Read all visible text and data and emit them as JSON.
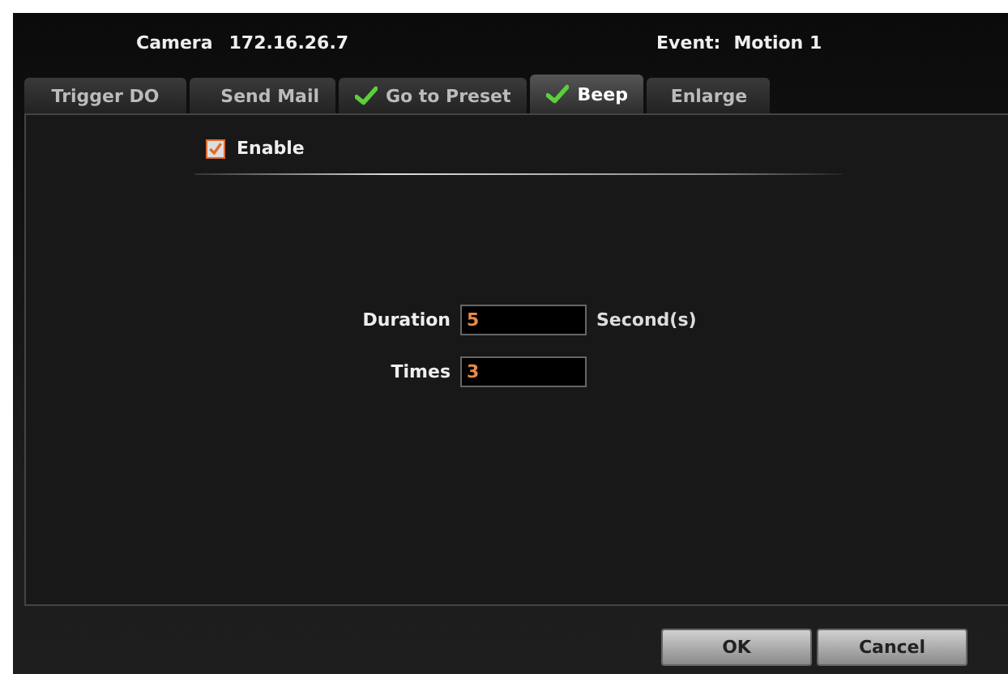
{
  "header": {
    "camera_label": "Camera",
    "camera_value": "172.16.26.7",
    "event_label": "Event:",
    "event_value": "Motion 1"
  },
  "tabs": [
    {
      "label": "Trigger DO",
      "checked": false,
      "selected": false
    },
    {
      "label": "Send Mail",
      "checked": false,
      "selected": false
    },
    {
      "label": "Go to Preset",
      "checked": true,
      "selected": false
    },
    {
      "label": "Beep",
      "checked": true,
      "selected": true
    },
    {
      "label": "Enlarge",
      "checked": false,
      "selected": false
    }
  ],
  "enable": {
    "label": "Enable",
    "checked": true
  },
  "fields": [
    {
      "label": "Duration",
      "value": "5",
      "unit": "Second(s)"
    },
    {
      "label": "Times",
      "value": "3"
    }
  ],
  "buttons": [
    "OK",
    "Cancel"
  ]
}
